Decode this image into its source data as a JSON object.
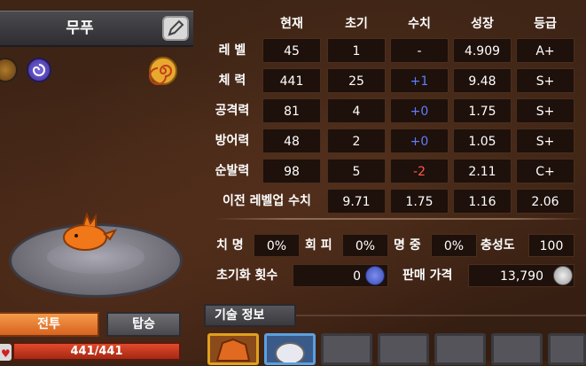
{
  "pet": {
    "name": "무푸",
    "hp_text": "441/441",
    "hp_fraction": 1.0
  },
  "buttons": {
    "battle": "전투",
    "ride": "탑승",
    "skill_info": "기술 정보"
  },
  "stats": {
    "headers": [
      "현재",
      "초기",
      "수치",
      "성장",
      "등급"
    ],
    "rows": [
      {
        "label": "레 벨",
        "current": "45",
        "initial": "1",
        "value": "-",
        "growth": "4.909",
        "grade": "A+"
      },
      {
        "label": "체 력",
        "current": "441",
        "initial": "25",
        "value": "+1",
        "growth": "9.48",
        "grade": "S+"
      },
      {
        "label": "공격력",
        "current": "81",
        "initial": "4",
        "value": "+0",
        "growth": "1.75",
        "grade": "S+"
      },
      {
        "label": "방어력",
        "current": "48",
        "initial": "2",
        "value": "+0",
        "growth": "1.05",
        "grade": "S+"
      },
      {
        "label": "순발력",
        "current": "98",
        "initial": "5",
        "value": "-2",
        "growth": "2.11",
        "grade": "C+"
      }
    ],
    "prev_label": "이전 레벨업 수치",
    "prev_values": [
      "9.71",
      "1.75",
      "1.16",
      "2.06"
    ]
  },
  "secondary": {
    "crit_label": "치 명",
    "crit": "0%",
    "evade_label": "회 피",
    "evade": "0%",
    "accuracy_label": "명 중",
    "accuracy": "0%",
    "loyalty_label": "충성도",
    "loyalty": "100",
    "reset_label": "초기화 횟수",
    "reset": "0",
    "price_label": "판매 가격",
    "price": "13,790"
  },
  "colors": {
    "positive": "#5d7dff",
    "negative": "#ff5a4a",
    "battle_button": "#e87a30",
    "hp_bar": "#c83a20"
  }
}
